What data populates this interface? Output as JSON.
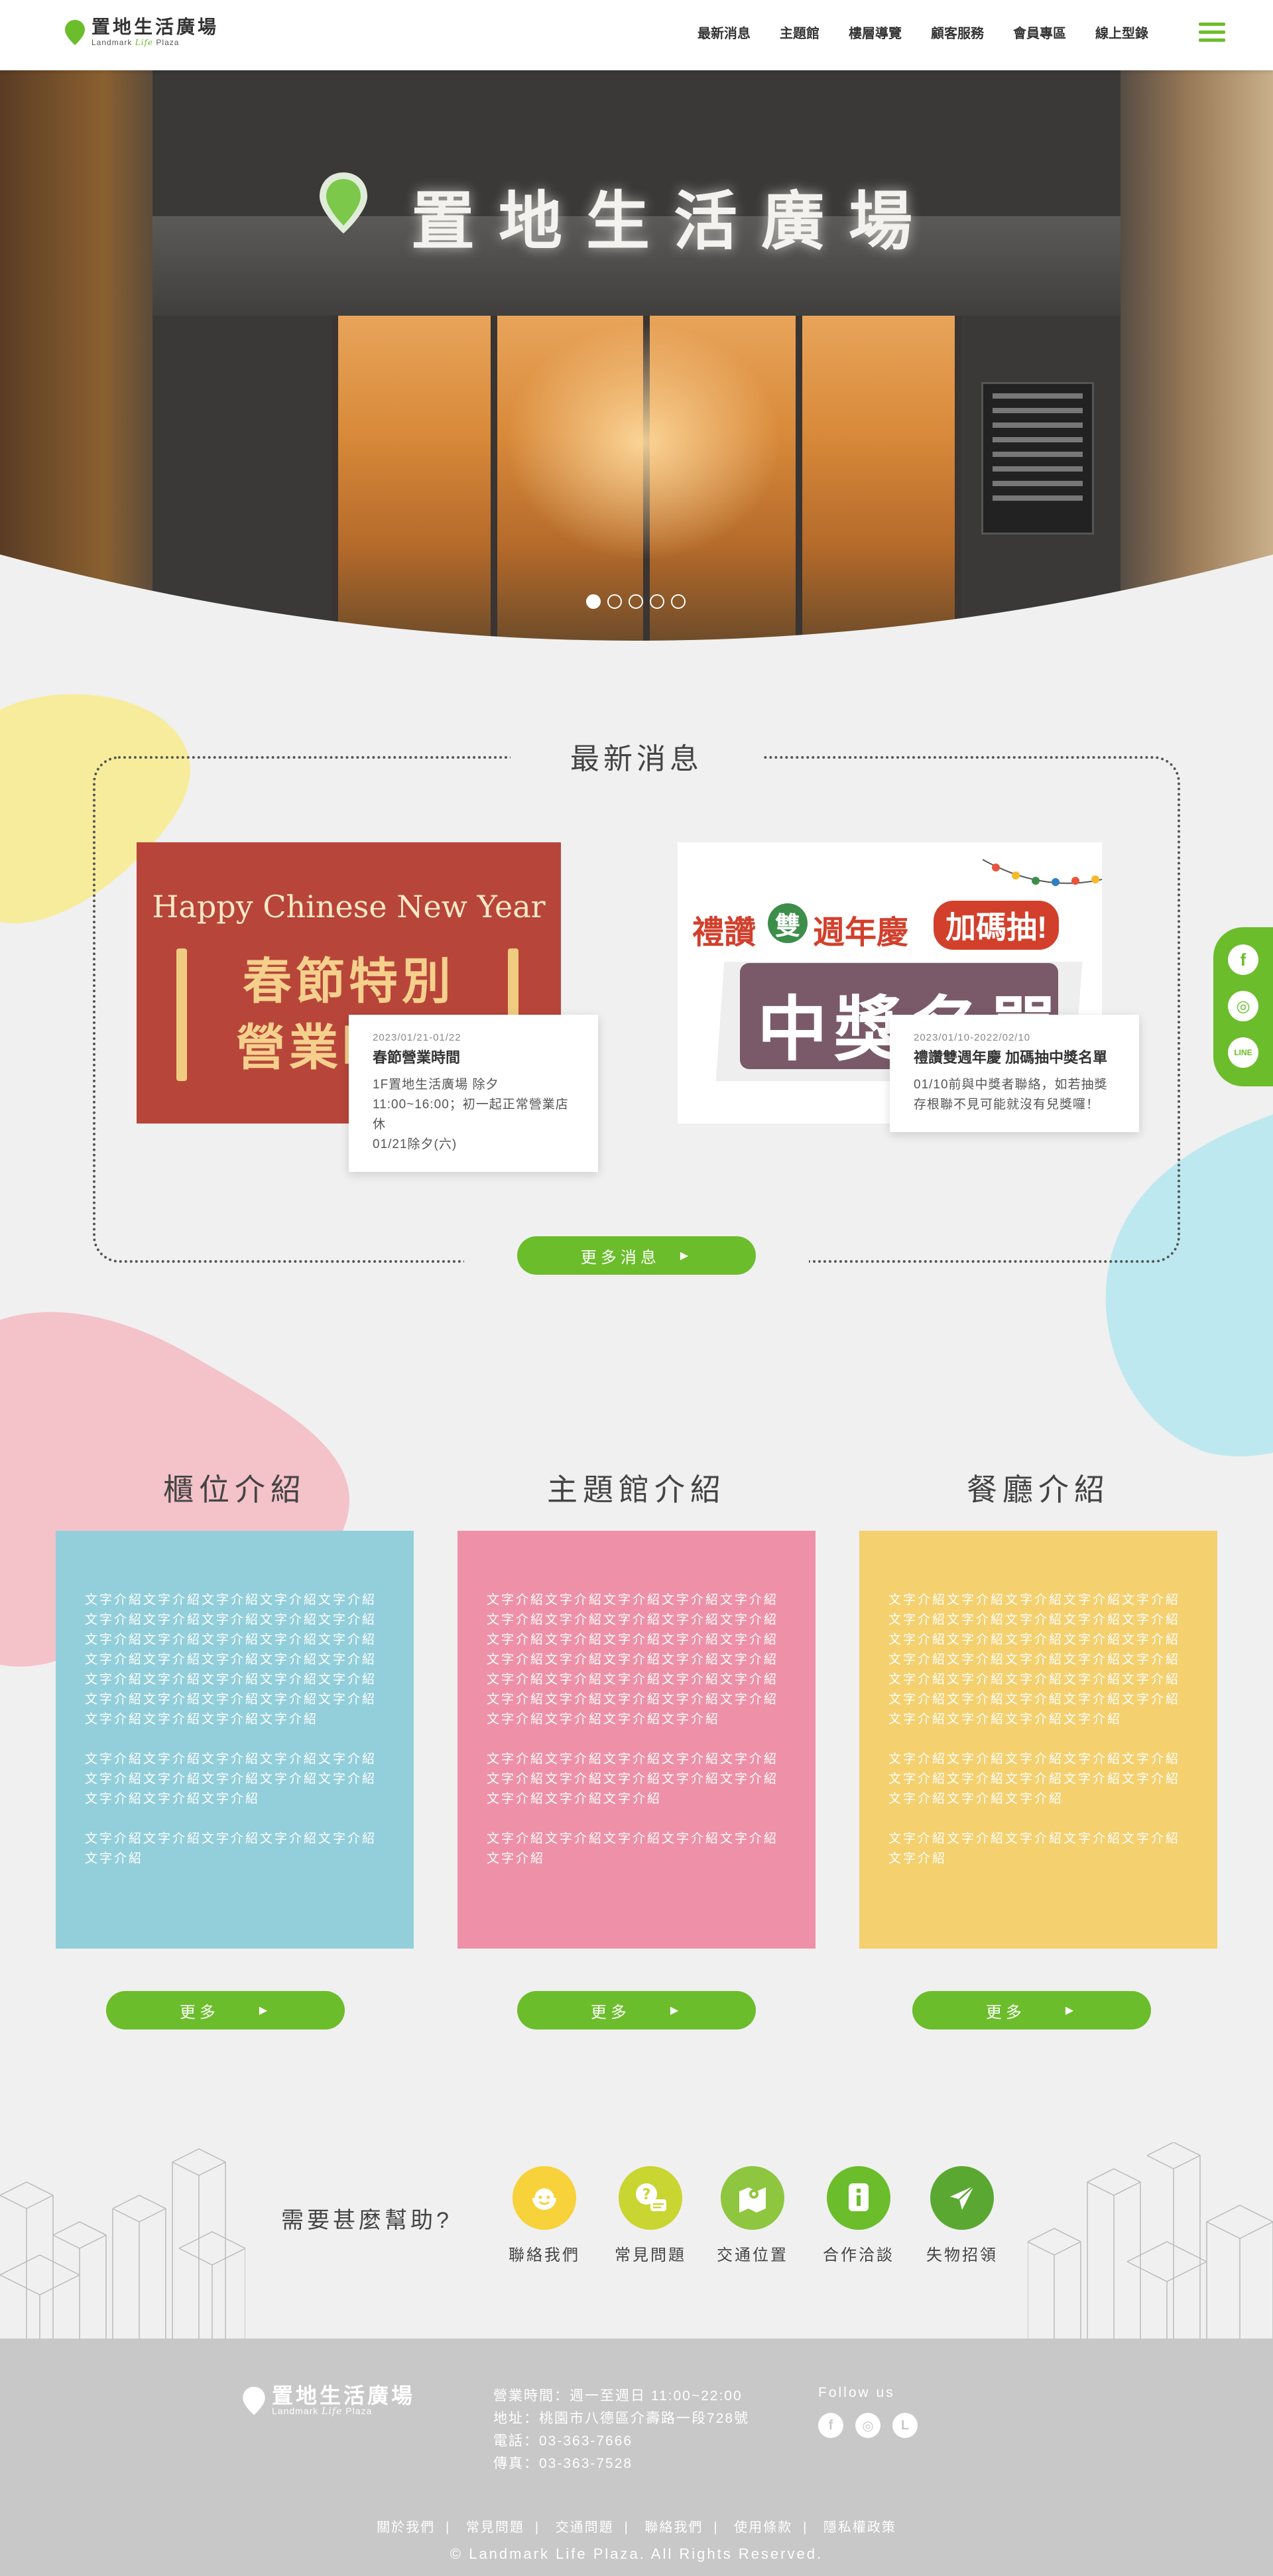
{
  "header": {
    "logo_zh": "置地生活廣場",
    "logo_en_left": "Landmark",
    "logo_en_mid": "Life",
    "logo_en_right": "Plaza",
    "nav": [
      "最新消息",
      "主題館",
      "樓層導覽",
      "顧客服務",
      "會員專區",
      "線上型錄"
    ]
  },
  "hero": {
    "sign_text": "置地生活廣場",
    "slide_count": 5,
    "active_slide": 1
  },
  "news": {
    "title": "最新消息",
    "items": [
      {
        "image_line1": "Happy Chinese New Year",
        "image_line2": "春節特別",
        "image_line3": "營業時間",
        "date": "2023/01/21-01/22",
        "headline": "春節營業時間",
        "body": "1F置地生活廣場 除夕 11:00~16:00；初一起正常營業店休",
        "body2": "01/21除夕(六)"
      },
      {
        "image_line1": "禮讚",
        "image_badge": "雙",
        "image_line2": "週年慶",
        "image_tag": "加碼抽!",
        "image_line3": "中獎名單",
        "date": "2023/01/10-2022/02/10",
        "headline": "禮讚雙週年慶 加碼抽中獎名單",
        "body": "01/10前與中獎者聯絡，如若抽獎存根聯不見可能就沒有兒獎囉！"
      }
    ],
    "more_label": "更多消息"
  },
  "social": [
    "f",
    "◎",
    "LINE"
  ],
  "intro": [
    {
      "title": "櫃位介紹",
      "color": "#93cfdb",
      "p1": "文字介紹文字介紹文字介紹文字介紹文字介紹文字介紹文字介紹文字介紹文字介紹文字介紹文字介紹文字介紹文字介紹文字介紹文字介紹文字介紹文字介紹文字介紹文字介紹文字介紹文字介紹文字介紹文字介紹文字介紹文字介紹文字介紹文字介紹文字介紹文字介紹文字介紹文字介紹文字介紹文字介紹文字介紹",
      "p2": "文字介紹文字介紹文字介紹文字介紹文字介紹文字介紹文字介紹文字介紹文字介紹文字介紹文字介紹文字介紹文字介紹",
      "p3": "文字介紹文字介紹文字介紹文字介紹文字介紹文字介紹",
      "more": "更多"
    },
    {
      "title": "主題館介紹",
      "color": "#ee91a8",
      "p1": "文字介紹文字介紹文字介紹文字介紹文字介紹文字介紹文字介紹文字介紹文字介紹文字介紹文字介紹文字介紹文字介紹文字介紹文字介紹文字介紹文字介紹文字介紹文字介紹文字介紹文字介紹文字介紹文字介紹文字介紹文字介紹文字介紹文字介紹文字介紹文字介紹文字介紹文字介紹文字介紹文字介紹文字介紹",
      "p2": "文字介紹文字介紹文字介紹文字介紹文字介紹文字介紹文字介紹文字介紹文字介紹文字介紹文字介紹文字介紹文字介紹",
      "p3": "文字介紹文字介紹文字介紹文字介紹文字介紹文字介紹",
      "more": "更多"
    },
    {
      "title": "餐廳介紹",
      "color": "#f4d06f",
      "p1": "文字介紹文字介紹文字介紹文字介紹文字介紹文字介紹文字介紹文字介紹文字介紹文字介紹文字介紹文字介紹文字介紹文字介紹文字介紹文字介紹文字介紹文字介紹文字介紹文字介紹文字介紹文字介紹文字介紹文字介紹文字介紹文字介紹文字介紹文字介紹文字介紹文字介紹文字介紹文字介紹文字介紹文字介紹",
      "p2": "文字介紹文字介紹文字介紹文字介紹文字介紹文字介紹文字介紹文字介紹文字介紹文字介紹文字介紹文字介紹文字介紹",
      "p3": "文字介紹文字介紹文字介紹文字介紹文字介紹文字介紹",
      "more": "更多"
    }
  ],
  "help": {
    "label": "需要甚麼幫助?",
    "items": [
      {
        "label": "聯絡我們",
        "icon": "headset-icon",
        "color": "#f7d23a"
      },
      {
        "label": "常見問題",
        "icon": "question-chat-icon",
        "color": "#c9d530"
      },
      {
        "label": "交通位置",
        "icon": "map-icon",
        "color": "#8ec63f"
      },
      {
        "label": "合作洽談",
        "icon": "document-icon",
        "color": "#6bbd2b"
      },
      {
        "label": "失物招領",
        "icon": "paper-plane-icon",
        "color": "#5aa832"
      }
    ]
  },
  "footer": {
    "logo_zh": "置地生活廣場",
    "hours": "營業時間：週一至週日 11:00~22:00",
    "address": "地址：桃園市八德區介壽路一段728號",
    "phone": "電話：03-363-7666",
    "fax": "傳真：03-363-7528",
    "follow": "Follow us",
    "social": [
      "f",
      "◎",
      "L"
    ],
    "links": [
      "關於我們",
      "常見問題",
      "交通問題",
      "聯絡我們",
      "使用條款",
      "隱私權政策"
    ],
    "copyright": "© Landmark Life Plaza. All Rights Reserved."
  },
  "colors": {
    "brand_green": "#6bbd2b",
    "footer_gray": "#c8c8c8",
    "page_bg": "#f0f0f0"
  }
}
